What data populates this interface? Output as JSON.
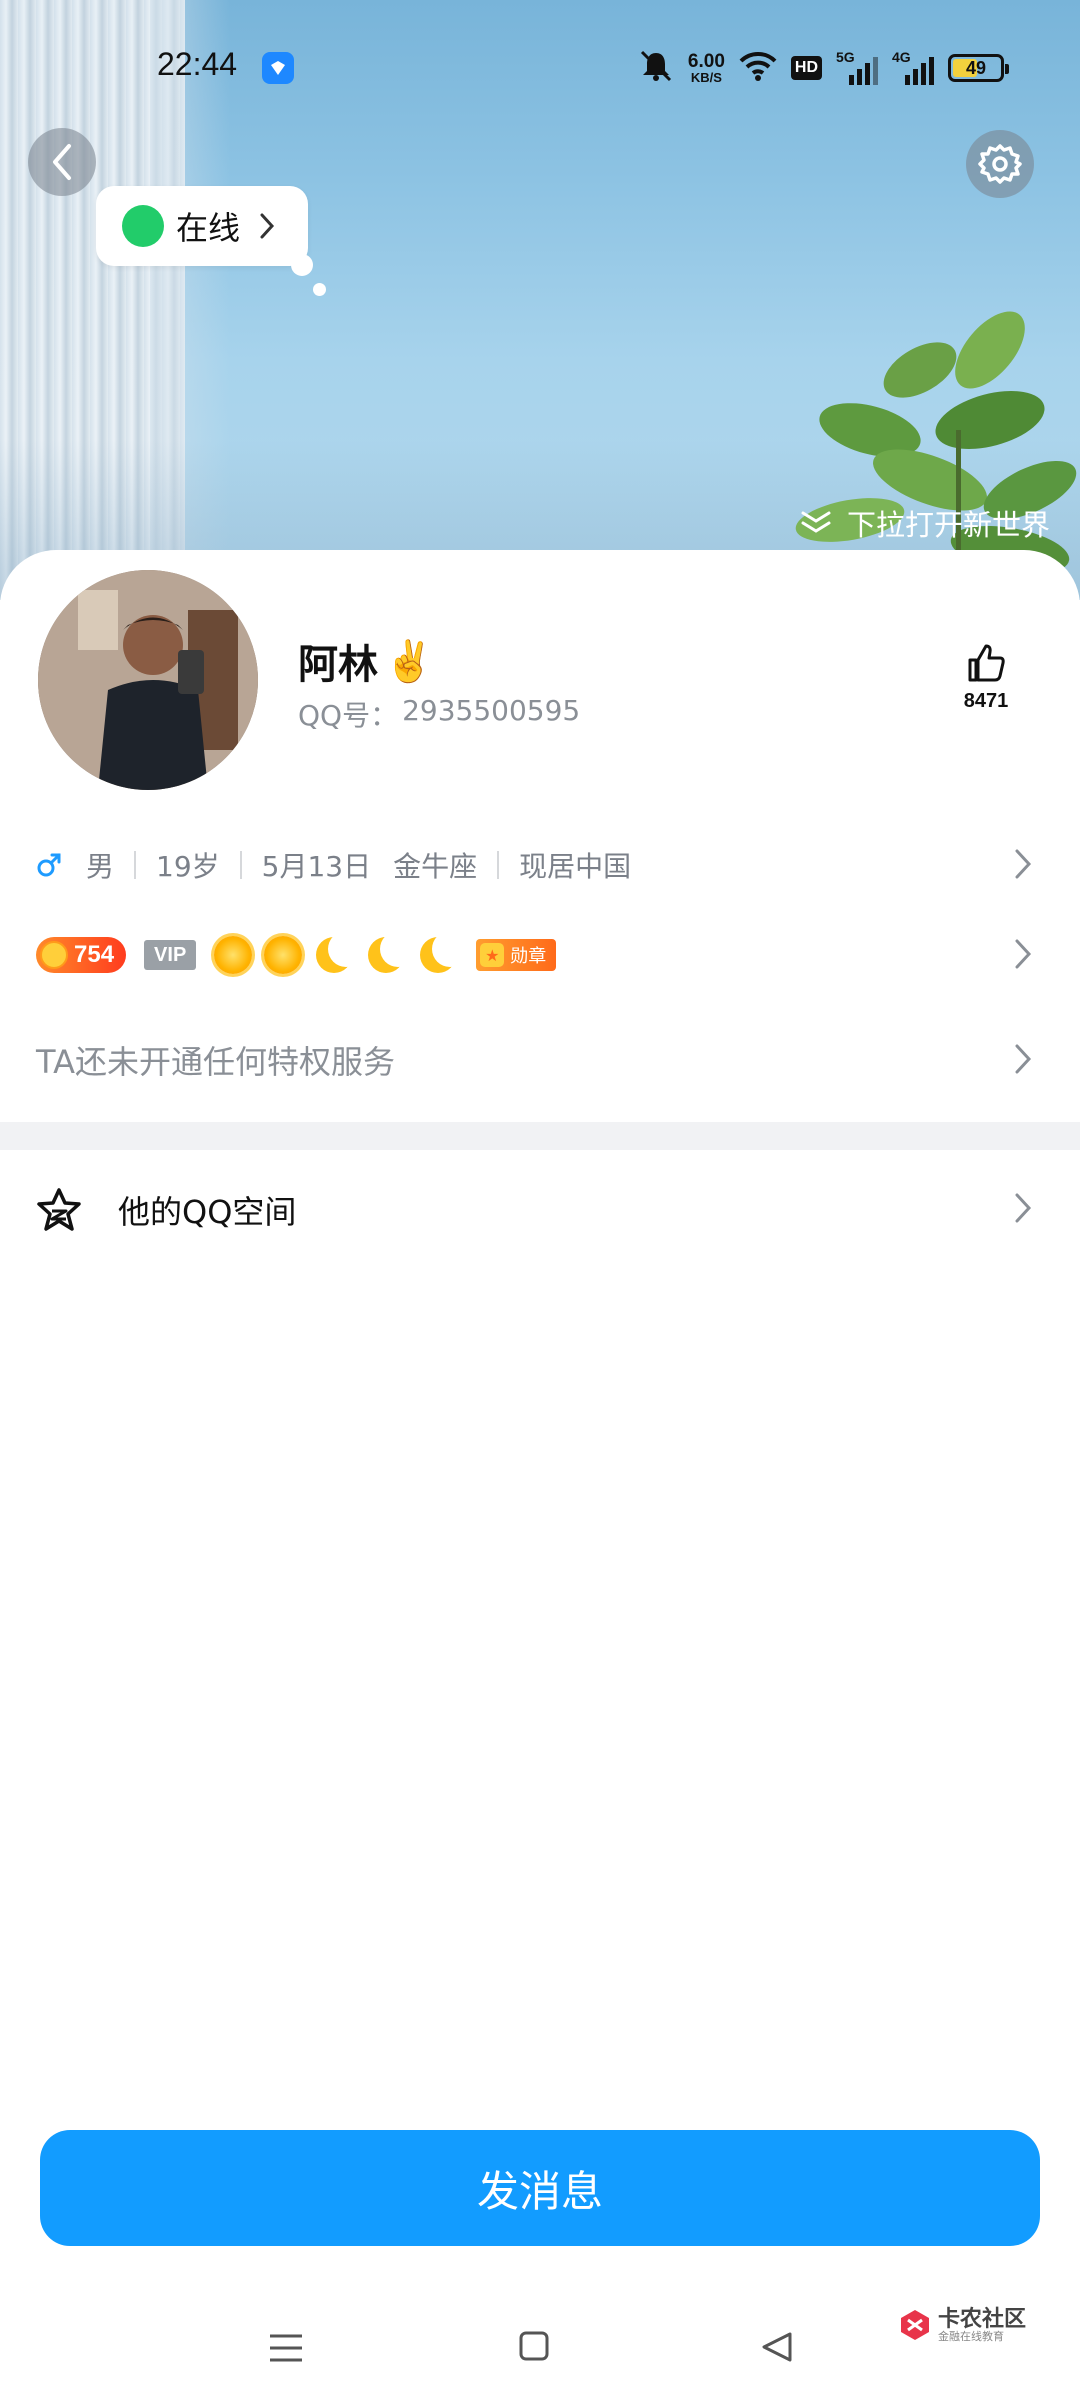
{
  "status_bar": {
    "time": "22:44",
    "net_speed_value": "6.00",
    "net_speed_unit": "KB/S",
    "hd_label": "HD",
    "sim1_tag": "5G",
    "sim2_tag": "4G",
    "battery_level": "49",
    "icons": [
      "app-notification-icon",
      "bell-muted-icon",
      "wifi-icon",
      "signal-icon",
      "battery-icon"
    ]
  },
  "header": {
    "online_status": "在线",
    "pull_hint": "下拉打开新世界",
    "icons": [
      "back-icon",
      "settings-icon",
      "chevron-right-icon",
      "double-chevron-down-icon"
    ]
  },
  "profile": {
    "nickname": "阿林",
    "nickname_emoji": "✌️",
    "qq_label": "QQ号：",
    "qq_number": "2935500595",
    "likes": "8471"
  },
  "info": {
    "gender": "男",
    "age": "19岁",
    "birthday": "5月13日",
    "zodiac": "金牛座",
    "location": "现居中国"
  },
  "badges": {
    "level": "754",
    "vip": "VIP",
    "medal": "勋章",
    "level_icons": [
      "sun-icon",
      "sun-icon",
      "moon-icon",
      "moon-icon",
      "moon-icon"
    ]
  },
  "privilege": {
    "text": "TA还未开通任何特权服务"
  },
  "qzone": {
    "label": "他的QQ空间"
  },
  "actions": {
    "send_message": "发消息"
  },
  "watermark": {
    "main": "卡农社区",
    "sub": "金融在线教育"
  },
  "colors": {
    "primary_button": "#129cff",
    "online_green": "#22cc6a",
    "muted_text": "#8a8f96",
    "level_badge": "#ff3c1e"
  }
}
